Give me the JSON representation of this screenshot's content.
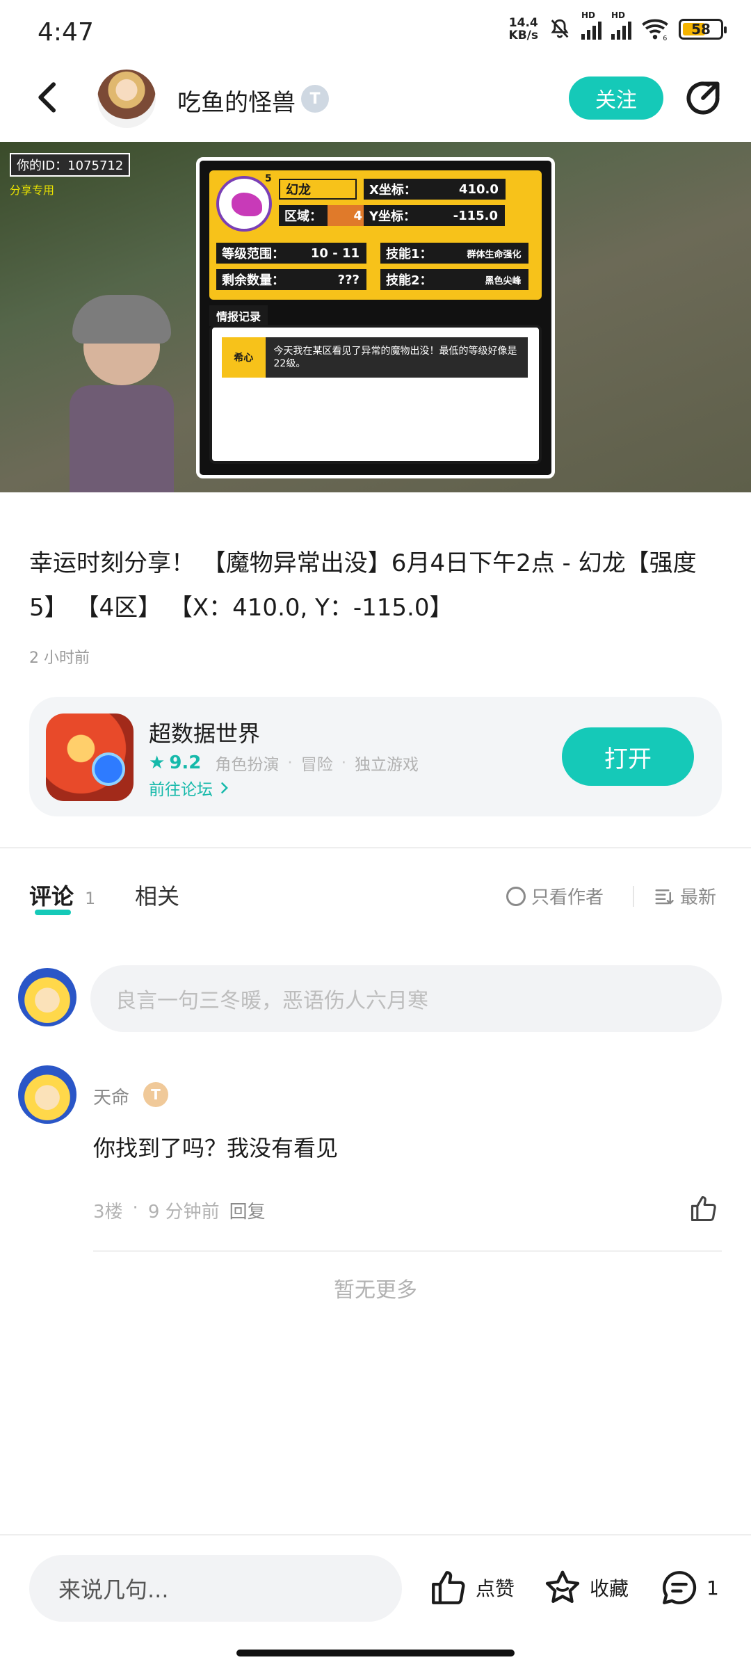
{
  "status_bar": {
    "time": "4:47",
    "net_speed_value": "14.4",
    "net_speed_unit": "KB/s",
    "signal_label_1": "HD",
    "signal_label_2": "HD",
    "wifi_sub": "6",
    "battery": "58"
  },
  "header": {
    "author_name": "吃鱼的怪兽",
    "badge": "T",
    "follow_label": "关注",
    "back_icon": "chevron-left-icon",
    "share_icon": "share-icon"
  },
  "game_image": {
    "id_label": "你的ID：1075712",
    "share_only": "分享专用",
    "monster_name": "幻龙",
    "monster_level": "5",
    "area_label": "区域：",
    "area_value": "4",
    "x_label": "X坐标：",
    "x_value": "410.0",
    "y_label": "Y坐标：",
    "y_value": "-115.0",
    "level_range_label": "等级范围：",
    "level_range_value": "10 - 11",
    "remaining_label": "剩余数量：",
    "remaining_value": "???",
    "skill1_label": "技能1：",
    "skill1_value": "群体生命强化",
    "skill2_label": "技能2：",
    "skill2_value": "黑色尖峰",
    "intel_label": "情报记录",
    "message_speaker": "希心",
    "message_text": "今天我在某区看见了异常的魔物出没！最低的等级好像是22级。"
  },
  "post": {
    "text": "幸运时刻分享！ 【魔物异常出没】6月4日下午2点 - 幻龙【强度5】 【4区】 【X：410.0, Y：-115.0】",
    "time": "2 小时前"
  },
  "app_card": {
    "name": "超数据世界",
    "score": "9.2",
    "tags": [
      "角色扮演",
      "冒险",
      "独立游戏"
    ],
    "forum_link": "前往论坛",
    "open_label": "打开"
  },
  "tabs": {
    "comments_label": "评论",
    "comments_count": "1",
    "related_label": "相关",
    "only_author": "只看作者",
    "sort_label": "最新"
  },
  "comment_input": {
    "placeholder": "良言一句三冬暖，恶语伤人六月寒"
  },
  "comments": [
    {
      "user": "天命",
      "badge": "T",
      "text": "你找到了吗？我没有看见",
      "floor": "3楼",
      "time": "9 分钟前",
      "reply_label": "回复"
    }
  ],
  "no_more": "暂无更多",
  "bottom_bar": {
    "input_placeholder": "来说几句...",
    "like_label": "点赞",
    "fav_label": "收藏",
    "comment_count": "1"
  },
  "colors": {
    "accent": "#15c9b8",
    "text_primary": "#1b1b1b",
    "text_secondary": "#9a9a9a",
    "card_bg": "#f3f5f7"
  }
}
